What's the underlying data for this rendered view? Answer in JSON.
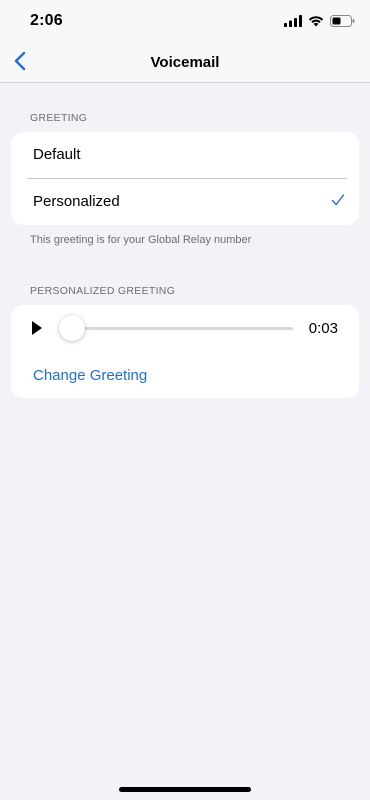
{
  "status_bar": {
    "time": "2:06",
    "icons": [
      "cellular-signal-icon",
      "wifi-icon",
      "battery-icon"
    ]
  },
  "nav": {
    "title": "Voicemail",
    "back_icon": "chevron-left-icon"
  },
  "greeting_section": {
    "header": "GREETING",
    "options": [
      {
        "label": "Default",
        "selected": false
      },
      {
        "label": "Personalized",
        "selected": true
      }
    ],
    "footer": "This greeting is for your Global Relay number"
  },
  "personalized_section": {
    "header": "PERSONALIZED GREETING",
    "player": {
      "play_icon": "play-icon",
      "progress": 0.0,
      "duration": "0:03"
    },
    "change_label": "Change Greeting"
  },
  "colors": {
    "accent": "#1e6fd9",
    "background": "#f2f2f7",
    "card": "#ffffff",
    "secondary_text": "#6d6d72"
  }
}
